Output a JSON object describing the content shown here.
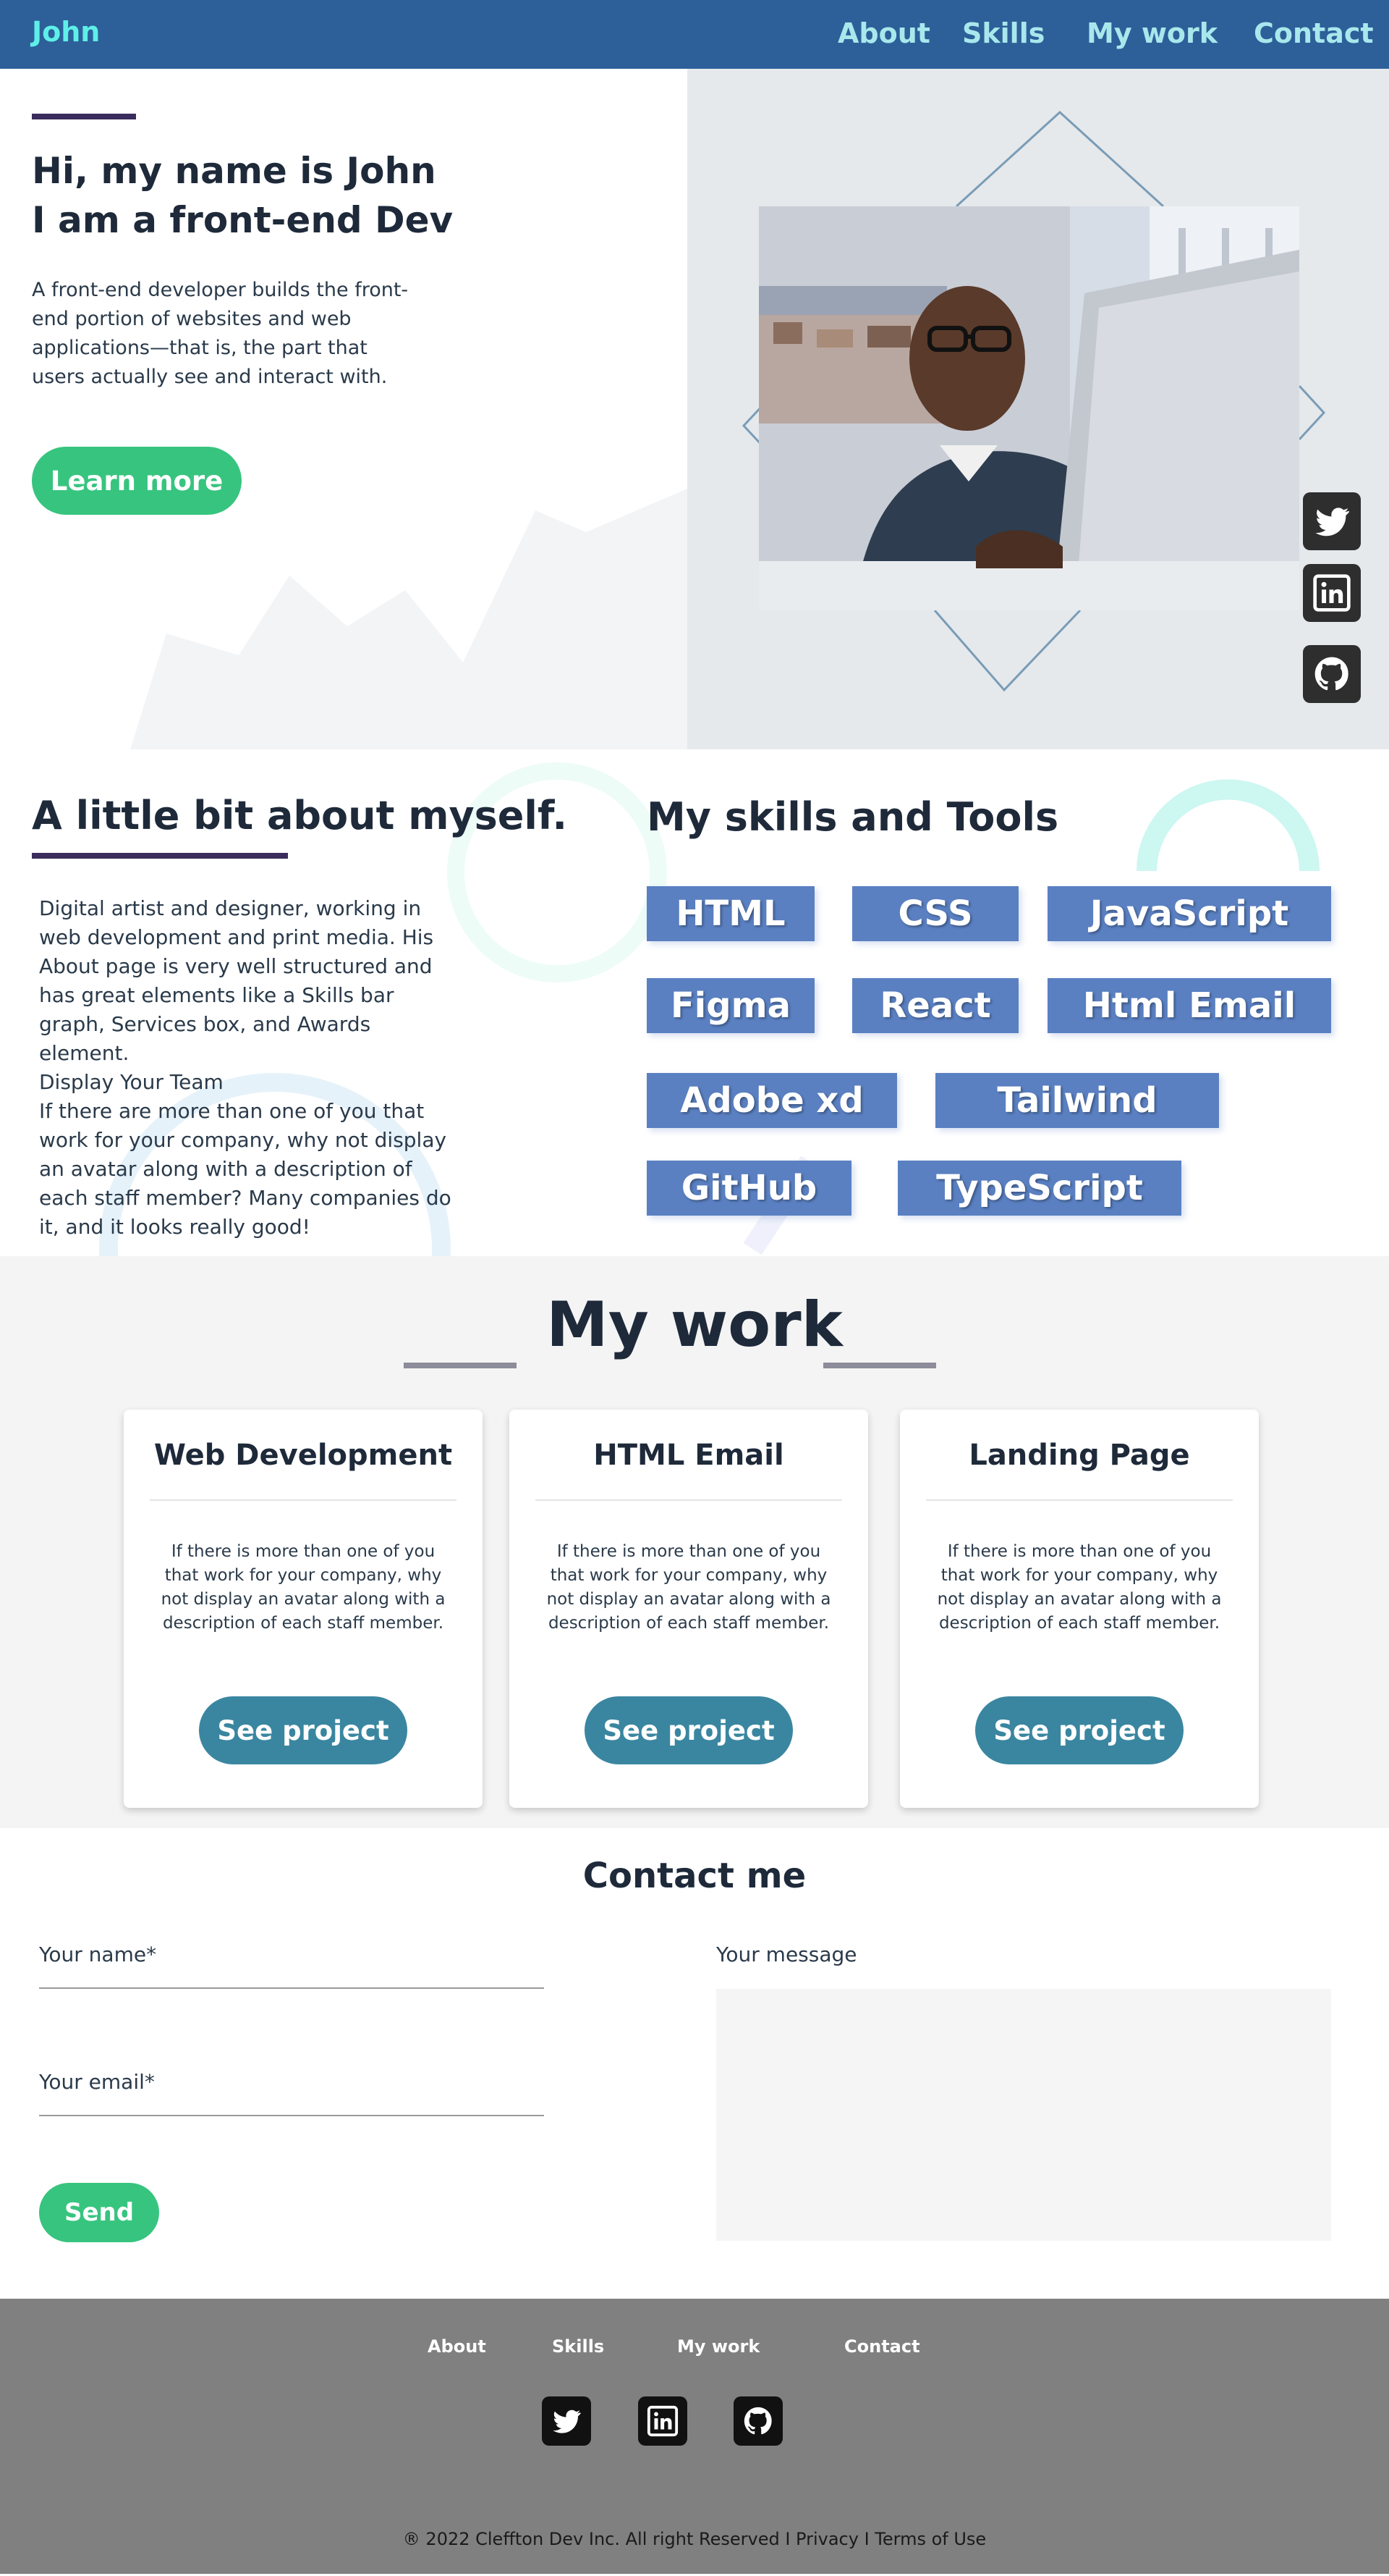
{
  "nav": {
    "brand": "John",
    "links": [
      "About",
      "Skills",
      "My work",
      "Contact"
    ]
  },
  "hero": {
    "greeting": "Hi, my name is John",
    "role_prefix": "I am a ",
    "role_bold": "front-end Dev",
    "description": "A front-end developer builds the front-end portion of websites and web applications—that is, the part that users actually see and interact with.",
    "button_label": "Learn more"
  },
  "social": {
    "icons": [
      "twitter-icon",
      "linkedin-icon",
      "github-icon"
    ]
  },
  "about": {
    "title": "A little bit about myself.",
    "paragraph1": "Digital artist and designer, working in web development and print media. His About page is very well structured and has great elements like a Skills bar graph, Services box, and Awards element.",
    "paragraph2_heading": "Display Your Team",
    "paragraph2": "If there are more than one of you that work for your company, why not display an avatar along with a description of each staff member? Many companies do it, and it looks really good!"
  },
  "skills": {
    "title": "My skills and Tools",
    "items": [
      "HTML",
      "CSS",
      "JavaScript",
      "Figma",
      "React",
      "Html Email",
      "Adobe xd",
      "Tailwind",
      "GitHub",
      "TypeScript"
    ]
  },
  "work": {
    "title": "My work",
    "cards": [
      {
        "title": "Web Development",
        "text": "If there is more than one of you that work for your company, why not display an avatar along with a description of each staff member.",
        "button": "See project"
      },
      {
        "title": "HTML Email",
        "text": "If there is more than one of you that work for your company, why not display an avatar along with a description of each staff member.",
        "button": "See project"
      },
      {
        "title": "Landing Page",
        "text": "If there is more than one of you that work for your company, why not display an avatar along with a description of each staff member.",
        "button": "See project"
      }
    ]
  },
  "contact": {
    "title": "Contact me",
    "name_label": "Your name*",
    "email_label": "Your email*",
    "message_label": "Your message",
    "send_label": "Send"
  },
  "footer": {
    "links": [
      "About",
      "Skills",
      "My work",
      "Contact"
    ],
    "copyright": "® 2022 Cleffton Dev Inc. All right Reserved I Privacy I Terms of Use"
  },
  "colors": {
    "nav_bg": "#2d5f99",
    "brand": "#5ef0e8",
    "accent_green": "#37c47f",
    "skill_chip": "#5a80c2",
    "work_button": "#3a86a0",
    "footer_bg": "#808080"
  }
}
